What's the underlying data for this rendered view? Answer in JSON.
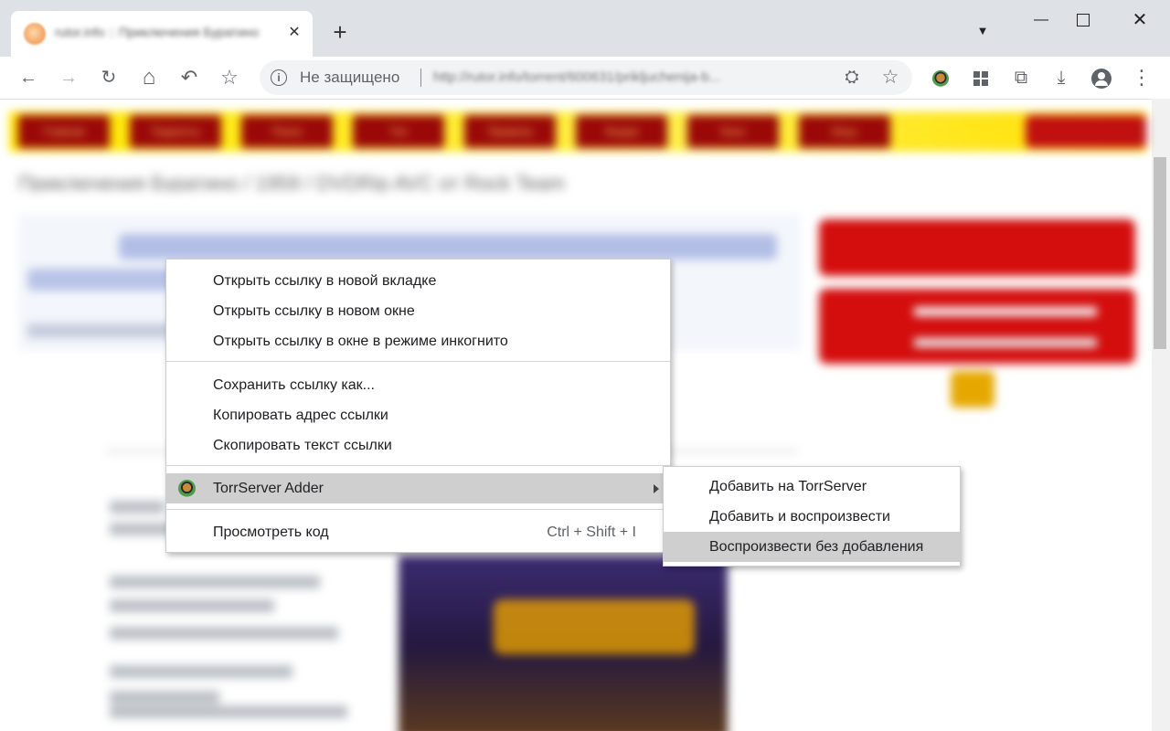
{
  "browser": {
    "tab": {
      "title": "rutor.info :: Приключения Буратино",
      "close_icon": "close-icon"
    },
    "new_tab_symbol": "+",
    "tab_search_symbol": "▾",
    "window_controls": {
      "minimize": "—",
      "close": "✕"
    },
    "nav": {
      "back": "←",
      "forward": "→",
      "reload": "↻",
      "home": "⌂",
      "undo": "↶",
      "bookmark": "☆"
    },
    "omnibox": {
      "security_label": "Не защищено",
      "url": "http://rutor.info/torrent/600631/prikljuchenija-b...",
      "info_icon": "i",
      "star": "☆",
      "site_icon": "⛭"
    },
    "toolbar_icons": {
      "crop": "⧉",
      "download": "⤓",
      "menu": "⋮"
    }
  },
  "page": {
    "heading": "Приключения Буратино / 1959 / DVDRip AVC от Rock Team",
    "nav_items": [
      "Главная",
      "Торренты",
      "Поиск",
      "Топ",
      "Правила",
      "Форум",
      "Кино",
      "Игры"
    ]
  },
  "context_menu": {
    "items": [
      {
        "label": "Открыть ссылку в новой вкладке"
      },
      {
        "label": "Открыть ссылку в новом окне"
      },
      {
        "label": "Открыть ссылку в окне в режиме инкогнито"
      },
      {
        "label": "Сохранить ссылку как..."
      },
      {
        "label": "Копировать адрес ссылки"
      },
      {
        "label": "Скопировать текст ссылки"
      },
      {
        "label": "TorrServer Adder"
      },
      {
        "label": "Просмотреть код",
        "shortcut": "Ctrl + Shift + I"
      }
    ]
  },
  "submenu": {
    "items": [
      {
        "label": "Добавить на TorrServer"
      },
      {
        "label": "Добавить и воспроизвести"
      },
      {
        "label": "Воспроизвести без добавления"
      }
    ]
  }
}
